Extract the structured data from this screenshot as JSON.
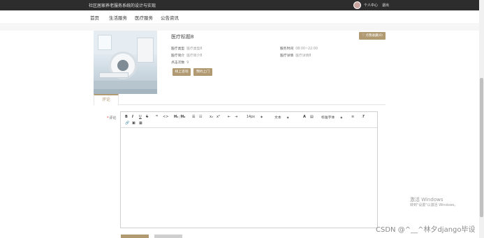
{
  "topbar": {
    "site_title": "社区居家养老服务系统的设计与实现",
    "user_link": "个人中心",
    "logout": "退出"
  },
  "nav": {
    "items": [
      "首页",
      "生活服务",
      "医疗服务",
      "公告资讯"
    ]
  },
  "product": {
    "title": "医疗标题8",
    "favorite_label": "点我收藏(0)",
    "fields": [
      {
        "label": "医疗类型",
        "value": "医疗类型8"
      },
      {
        "label": "服务时间",
        "value": "08:00~22:00"
      },
      {
        "label": "医疗简介",
        "value": "医疗简介8"
      },
      {
        "label": "医疗详情",
        "value": "医疗详情8"
      },
      {
        "label": "点击次数",
        "value": "9"
      }
    ],
    "buttons": [
      "线上咨询",
      "预约上门"
    ]
  },
  "tabs": {
    "active": "评论"
  },
  "comment": {
    "label": "评论",
    "required_mark": "*"
  },
  "editor": {
    "toolbar": {
      "bold": "B",
      "italic": "I",
      "underline": "U",
      "strike": "S",
      "quote": "❞",
      "code": "<>",
      "h1": "H₁",
      "h2": "H₂",
      "ol": "☰",
      "ul": "☷",
      "sub": "x₂",
      "sup": "x²",
      "outdent": "⇤",
      "indent": "⇥",
      "size": "14px",
      "font_type": "文本",
      "color": "A",
      "bg": "▤",
      "font_family": "标准字体",
      "align": "≡",
      "clear": "T̸",
      "link": "🔗",
      "image": "▣",
      "video": "▦"
    }
  },
  "watermark": {
    "windows_line1": "激活 Windows",
    "windows_line2": "转到\"设置\"以激活 Windows。",
    "csdn": "CSDN @^__^林夕django毕设"
  },
  "colors": {
    "accent": "#b19a72",
    "topbar": "#2d2d2d"
  }
}
